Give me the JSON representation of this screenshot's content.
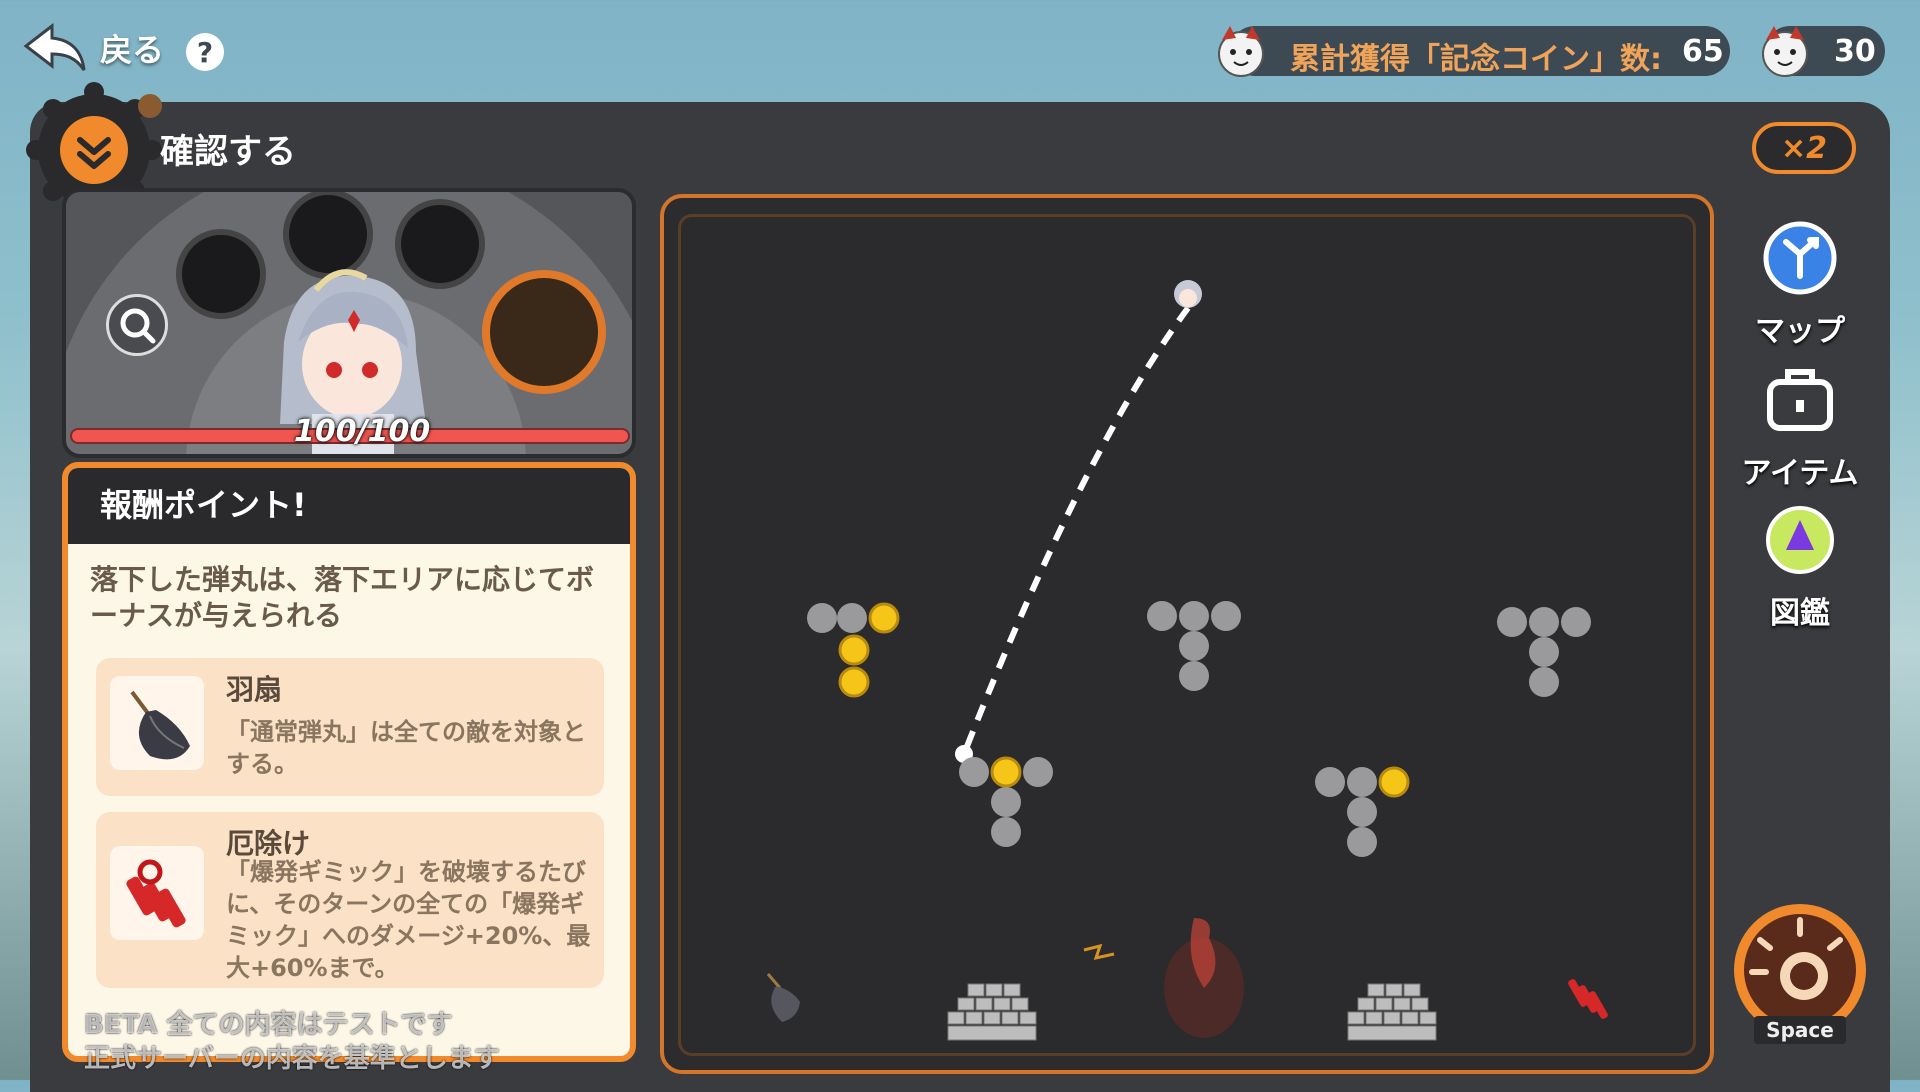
{
  "topbar": {
    "back_label": "戻る",
    "help_label": "?",
    "total_coin_label": "累計獲得「記念コイン」数:",
    "total_coin_value": "65",
    "coin_count": "30"
  },
  "panel": {
    "confirm_label": "確認する",
    "speed_label": "×2"
  },
  "character": {
    "hp_text": "100/100",
    "hp_fraction": 1.0
  },
  "reward": {
    "title": "報酬ポイント!",
    "description": "落下した弾丸は、落下エリアに応じてボーナスが与えられる",
    "items": [
      {
        "name": "羽扇",
        "icon": "feather-fan-icon",
        "description": "「通常弾丸」は全ての敵を対象とする。"
      },
      {
        "name": "厄除け",
        "icon": "firecracker-icon",
        "description": "「爆発ギミック」を破壊するたびに、そのターンの全ての「爆発ギミック」へのダメージ+20%、最大+60%まで。"
      }
    ]
  },
  "beta_notice": {
    "line1": "BETA 全ての内容はテストです",
    "line2": "正式サーバーの内容を基準とします"
  },
  "menu": {
    "map_label": "マップ",
    "item_label": "アイテム",
    "codex_label": "図鑑",
    "space_label": "Space"
  },
  "colors": {
    "accent": "#f08a2c",
    "hp": "#f0554f",
    "panel": "#3a3b3e",
    "coin": "#f5c518"
  }
}
